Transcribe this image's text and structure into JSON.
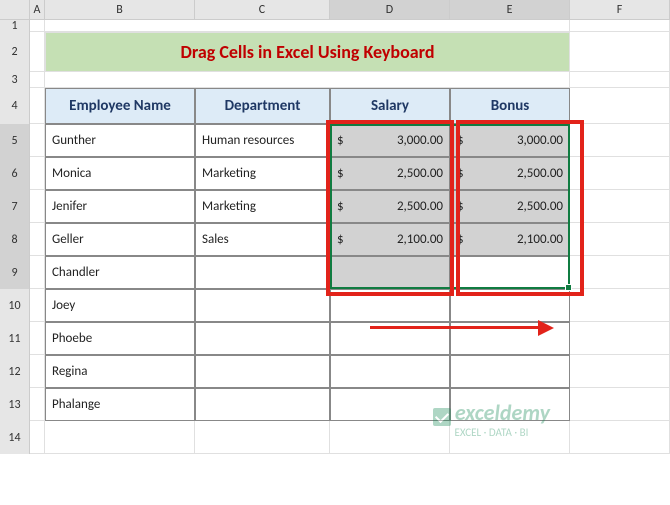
{
  "columns": {
    "A": "A",
    "B": "B",
    "C": "C",
    "D": "D",
    "E": "E",
    "F": "F"
  },
  "rowNums": [
    "1",
    "2",
    "3",
    "4",
    "5",
    "6",
    "7",
    "8",
    "9",
    "10",
    "11",
    "12",
    "13",
    "14"
  ],
  "title": "Drag Cells in Excel Using Keyboard",
  "headers": {
    "name": "Employee Name",
    "dept": "Department",
    "salary": "Salary",
    "bonus": "Bonus"
  },
  "rows": [
    {
      "name": "Gunther",
      "dept": "Human resources",
      "salary": "3,000.00",
      "bonus": "3,000.00"
    },
    {
      "name": "Monica",
      "dept": "Marketing",
      "salary": "2,500.00",
      "bonus": "2,500.00"
    },
    {
      "name": "Jenifer",
      "dept": "Marketing",
      "salary": "2,500.00",
      "bonus": "2,500.00"
    },
    {
      "name": "Geller",
      "dept": "Sales",
      "salary": "2,100.00",
      "bonus": "2,100.00"
    },
    {
      "name": "Chandler",
      "dept": "",
      "salary": "",
      "bonus": ""
    },
    {
      "name": "Joey",
      "dept": "",
      "salary": "",
      "bonus": ""
    },
    {
      "name": "Phoebe",
      "dept": "",
      "salary": "",
      "bonus": ""
    },
    {
      "name": "Regina",
      "dept": "",
      "salary": "",
      "bonus": ""
    },
    {
      "name": "Phalange",
      "dept": "",
      "salary": "",
      "bonus": ""
    }
  ],
  "currency": "$",
  "watermark": {
    "brand": "exceldemy",
    "tag": "EXCEL · DATA · BI"
  },
  "colors": {
    "titleBg": "#c5e0b4",
    "titleFg": "#c00000",
    "headerBg": "#ddebf7",
    "accent": "#e2231a",
    "selection": "#107c41"
  }
}
